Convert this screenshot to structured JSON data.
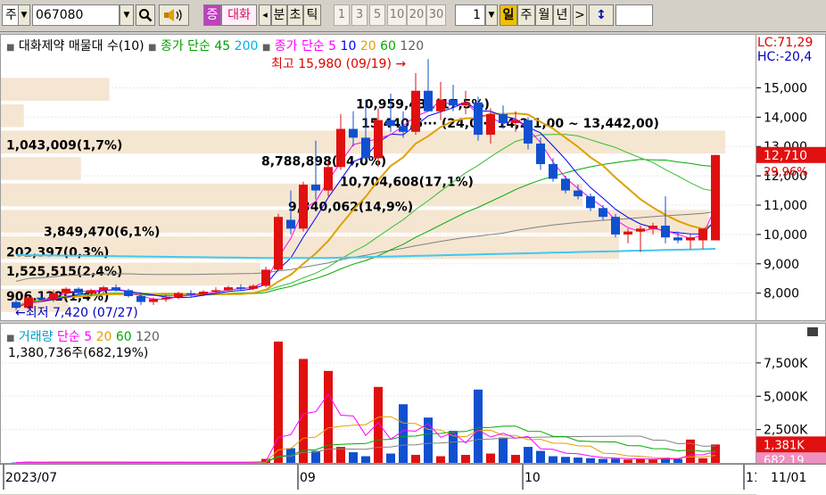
{
  "toolbar": {
    "mode": "주",
    "code": "067080",
    "search_icon": "search-icon",
    "speaker_icon": "speaker-icon",
    "tag": "증",
    "name": "대화",
    "arrow_left": "◂",
    "bun": "분",
    "cho": "초",
    "tik": "틱",
    "nums": [
      "1",
      "3",
      "5",
      "10",
      "20",
      "30"
    ],
    "count": "1",
    "periods": [
      "일",
      "주",
      "월",
      "년"
    ],
    "next": ">",
    "updown": "↕"
  },
  "price_panel": {
    "legend_prefix": "대화제약 매물대 수(10)",
    "ma_label_a": "종가 단순 45",
    "ma_label_a2": "200",
    "ma_label_b": "종가 단순 5",
    "ma_label_b_vals": [
      "10",
      "20",
      "60",
      "120"
    ],
    "ma_colors": [
      "#ff00ff",
      "#0000ff",
      "#e0a000",
      "#00aa00",
      "#606060"
    ],
    "high_label": "최고 15,980 (09/19) →",
    "low_label": "←최저 7,420 (07/27)",
    "lc_label": "LC:71,29",
    "hc_label": "HC:-20,4",
    "current_price": "12,710",
    "current_change": "29,96%",
    "range_label": "15,440,5··· (24,0··) 14,2·1,00 ~ 13,442,00)",
    "volume_profile": [
      {
        "text": "10,959,431(17,5%)",
        "value": 10959431,
        "pct": 17.5
      },
      {
        "text": "1,043,009(1,7%)",
        "value": 1043009,
        "pct": 1.7
      },
      {
        "text": "8,788,898(14,0%)",
        "value": 8788898,
        "pct": 14.0
      },
      {
        "text": "10,704,608(17,1%)",
        "value": 10704608,
        "pct": 17.1
      },
      {
        "text": "9,340,062(14,9%)",
        "value": 9340062,
        "pct": 14.9
      },
      {
        "text": "3,849,470(6,1%)",
        "value": 3849470,
        "pct": 6.1
      },
      {
        "text": "202,397(0,3%)",
        "value": 202397,
        "pct": 0.3
      },
      {
        "text": "1,525,515(2,4%)",
        "value": 1525515,
        "pct": 2.4
      },
      {
        "text": "906,122(1,4%)",
        "value": 906122,
        "pct": 1.4
      }
    ],
    "yaxis": [
      "15,000",
      "14,000",
      "13,000",
      "12,000",
      "11,000",
      "10,000",
      "9,000",
      "8,000"
    ]
  },
  "volume_panel": {
    "legend": "거래량",
    "ma_label": "단순 5",
    "ma_vals": [
      "20",
      "60",
      "120"
    ],
    "current": "1,380,736주(682,19%)",
    "current_vol": "1,381K",
    "ma_value": "682,19",
    "yaxis": [
      "7,500K",
      "5,000K",
      "2,500K"
    ]
  },
  "xaxis": {
    "labels": [
      "2023/07",
      "09",
      "10",
      "11"
    ],
    "date": "11/01"
  },
  "chart_data": {
    "type": "candlestick",
    "candles": [
      {
        "o": 7700,
        "h": 7800,
        "l": 7420,
        "c": 7500
      },
      {
        "o": 7500,
        "h": 7900,
        "l": 7450,
        "c": 7850
      },
      {
        "o": 7850,
        "h": 8000,
        "l": 7750,
        "c": 7800
      },
      {
        "o": 7800,
        "h": 8100,
        "l": 7700,
        "c": 8000
      },
      {
        "o": 8000,
        "h": 8200,
        "l": 7900,
        "c": 8150
      },
      {
        "o": 8150,
        "h": 8200,
        "l": 7950,
        "c": 8000
      },
      {
        "o": 8000,
        "h": 8150,
        "l": 7900,
        "c": 8100
      },
      {
        "o": 8100,
        "h": 8250,
        "l": 8000,
        "c": 8200
      },
      {
        "o": 8200,
        "h": 8300,
        "l": 8050,
        "c": 8100
      },
      {
        "o": 8100,
        "h": 8150,
        "l": 7850,
        "c": 7900
      },
      {
        "o": 7900,
        "h": 8000,
        "l": 7600,
        "c": 7700
      },
      {
        "o": 7700,
        "h": 7850,
        "l": 7600,
        "c": 7800
      },
      {
        "o": 7800,
        "h": 7950,
        "l": 7700,
        "c": 7850
      },
      {
        "o": 7850,
        "h": 8050,
        "l": 7800,
        "c": 8000
      },
      {
        "o": 8000,
        "h": 8100,
        "l": 7850,
        "c": 7950
      },
      {
        "o": 7950,
        "h": 8100,
        "l": 7900,
        "c": 8050
      },
      {
        "o": 8050,
        "h": 8200,
        "l": 8000,
        "c": 8100
      },
      {
        "o": 8100,
        "h": 8250,
        "l": 8050,
        "c": 8200
      },
      {
        "o": 8200,
        "h": 8300,
        "l": 8100,
        "c": 8150
      },
      {
        "o": 8150,
        "h": 8300,
        "l": 8100,
        "c": 8250
      },
      {
        "o": 8250,
        "h": 8900,
        "l": 8200,
        "c": 8800
      },
      {
        "o": 8800,
        "h": 10700,
        "l": 8800,
        "c": 10600
      },
      {
        "o": 10500,
        "h": 11500,
        "l": 10000,
        "c": 10200
      },
      {
        "o": 10200,
        "h": 11800,
        "l": 10100,
        "c": 11700
      },
      {
        "o": 11700,
        "h": 13200,
        "l": 11200,
        "c": 11500
      },
      {
        "o": 11500,
        "h": 12500,
        "l": 11300,
        "c": 12300
      },
      {
        "o": 12300,
        "h": 14100,
        "l": 12200,
        "c": 13600
      },
      {
        "o": 13600,
        "h": 14200,
        "l": 13000,
        "c": 13300
      },
      {
        "o": 13300,
        "h": 14600,
        "l": 12500,
        "c": 12600
      },
      {
        "o": 12600,
        "h": 14300,
        "l": 12300,
        "c": 13900
      },
      {
        "o": 13900,
        "h": 14800,
        "l": 13500,
        "c": 13700
      },
      {
        "o": 13700,
        "h": 14200,
        "l": 13300,
        "c": 13500
      },
      {
        "o": 13500,
        "h": 15500,
        "l": 13400,
        "c": 14900
      },
      {
        "o": 14900,
        "h": 15980,
        "l": 14500,
        "c": 14200
      },
      {
        "o": 14200,
        "h": 15200,
        "l": 13900,
        "c": 14600
      },
      {
        "o": 14600,
        "h": 15100,
        "l": 14200,
        "c": 14400
      },
      {
        "o": 14400,
        "h": 14900,
        "l": 14100,
        "c": 14500
      },
      {
        "o": 14500,
        "h": 14700,
        "l": 13200,
        "c": 13400
      },
      {
        "o": 13400,
        "h": 14300,
        "l": 13100,
        "c": 14100
      },
      {
        "o": 14100,
        "h": 14400,
        "l": 13600,
        "c": 13800
      },
      {
        "o": 13800,
        "h": 14200,
        "l": 13500,
        "c": 13900
      },
      {
        "o": 13900,
        "h": 14000,
        "l": 12900,
        "c": 13100
      },
      {
        "o": 13100,
        "h": 13300,
        "l": 12200,
        "c": 12400
      },
      {
        "o": 12400,
        "h": 12600,
        "l": 11800,
        "c": 11900
      },
      {
        "o": 11900,
        "h": 12000,
        "l": 11400,
        "c": 11500
      },
      {
        "o": 11500,
        "h": 11700,
        "l": 11200,
        "c": 11300
      },
      {
        "o": 11300,
        "h": 11400,
        "l": 10800,
        "c": 10900
      },
      {
        "o": 10900,
        "h": 11000,
        "l": 10500,
        "c": 10600
      },
      {
        "o": 10600,
        "h": 10700,
        "l": 9900,
        "c": 10000
      },
      {
        "o": 10000,
        "h": 10200,
        "l": 9700,
        "c": 10100
      },
      {
        "o": 10100,
        "h": 10300,
        "l": 9400,
        "c": 10200
      },
      {
        "o": 10200,
        "h": 10400,
        "l": 10000,
        "c": 10300
      },
      {
        "o": 10300,
        "h": 11300,
        "l": 9700,
        "c": 9900
      },
      {
        "o": 9900,
        "h": 10100,
        "l": 9700,
        "c": 9800
      },
      {
        "o": 9800,
        "h": 10000,
        "l": 9500,
        "c": 9900
      },
      {
        "o": 9800,
        "h": 10200,
        "l": 9500,
        "c": 10200
      },
      {
        "o": 9800,
        "h": 12710,
        "l": 9800,
        "c": 12710
      }
    ],
    "volumes": [
      30,
      60,
      40,
      50,
      70,
      40,
      35,
      45,
      40,
      50,
      40,
      30,
      35,
      45,
      40,
      35,
      40,
      50,
      45,
      55,
      300,
      9100,
      1100,
      7800,
      900,
      6900,
      1200,
      800,
      500,
      5700,
      700,
      4400,
      600,
      3400,
      500,
      2400,
      600,
      5500,
      700,
      1900,
      600,
      1200,
      900,
      500,
      450,
      400,
      350,
      300,
      320,
      250,
      300,
      250,
      400,
      300,
      1750,
      350,
      1381
    ],
    "xlabels": [
      "2023/07",
      "09",
      "10",
      "11"
    ],
    "ylim_price": [
      7200,
      16200
    ],
    "ylim_volume": [
      0,
      9500
    ]
  }
}
